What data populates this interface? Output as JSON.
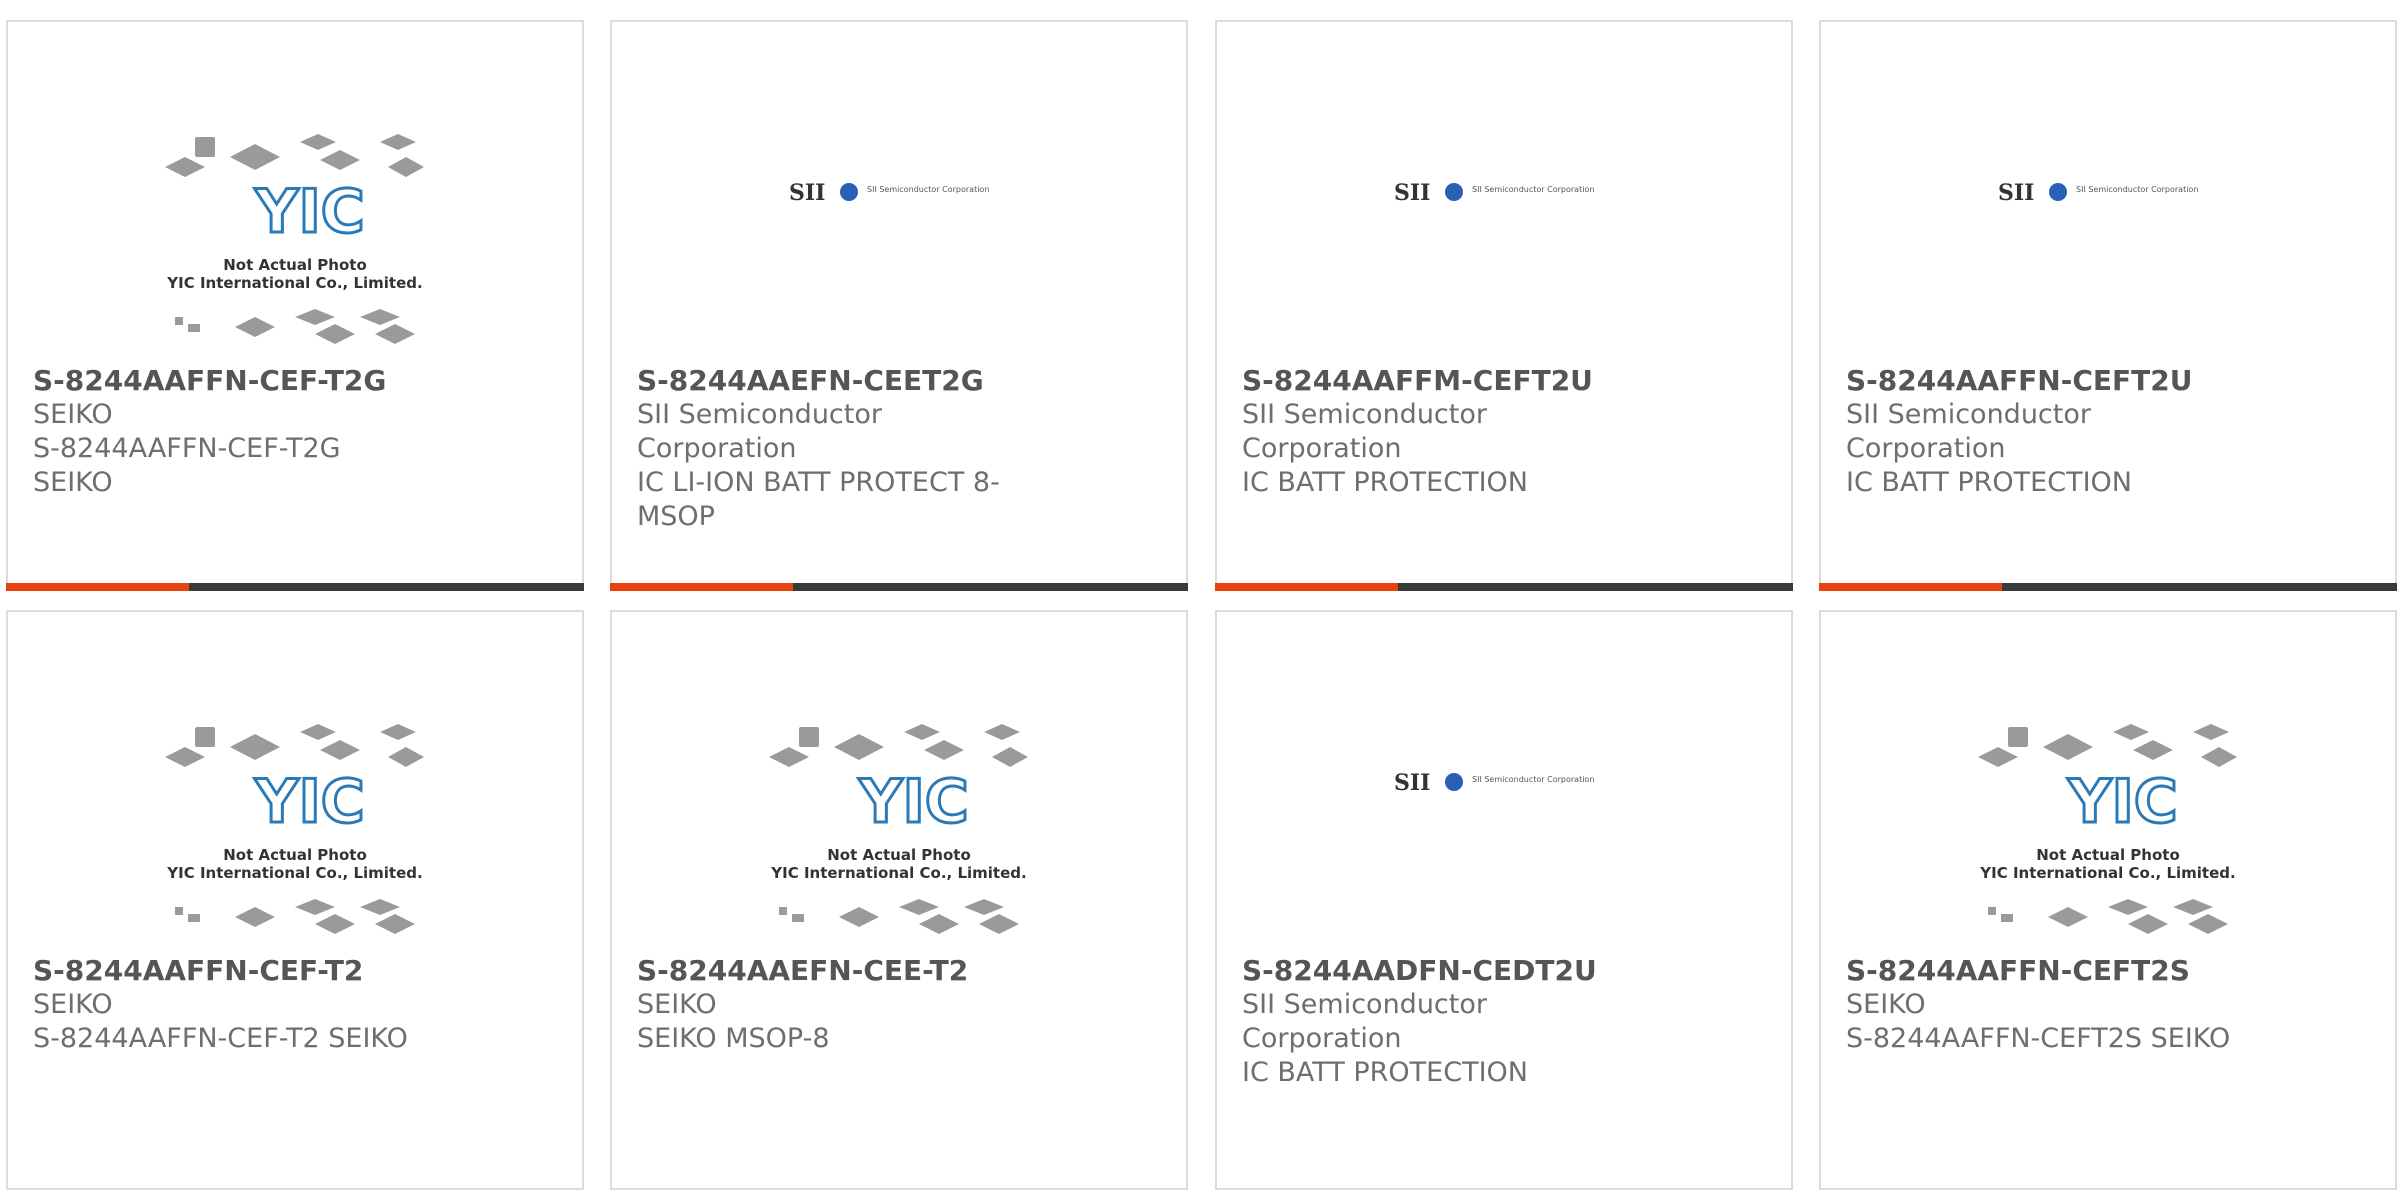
{
  "photo_caption": {
    "line1": "Not Actual Photo",
    "line2": "YIC International Co., Limited.",
    "logo": "YIC"
  },
  "sii_logo": {
    "mark": "SII",
    "company": "SII Semiconductor Corporation"
  },
  "colors": {
    "accent": "#e8420f",
    "bar": "#3a3a3a",
    "border": "#dcdcdc",
    "title": "#555555",
    "text": "#6e6e6e"
  },
  "products": [
    {
      "part": "S-8244AAFFN-CEF-T2G",
      "manufacturer": "SEIKO",
      "description": "S-8244AAFFN-CEF-T2G SEIKO",
      "image": "yic-placeholder"
    },
    {
      "part": "S-8244AAEFN-CEET2G",
      "manufacturer": "SII Semiconductor Corporation",
      "description": "IC LI-ION BATT PROTECT 8-MSOP",
      "image": "sii-logo"
    },
    {
      "part": "S-8244AAFFM-CEFT2U",
      "manufacturer": "SII Semiconductor Corporation",
      "description": "IC BATT PROTECTION",
      "image": "sii-logo"
    },
    {
      "part": "S-8244AAFFN-CEFT2U",
      "manufacturer": "SII Semiconductor Corporation",
      "description": "IC BATT PROTECTION",
      "image": "sii-logo"
    },
    {
      "part": "S-8244AAFFN-CEF-T2",
      "manufacturer": "SEIKO",
      "description": "S-8244AAFFN-CEF-T2 SEIKO",
      "image": "yic-placeholder"
    },
    {
      "part": "S-8244AAEFN-CEE-T2",
      "manufacturer": "SEIKO",
      "description": "SEIKO MSOP-8",
      "image": "yic-placeholder"
    },
    {
      "part": "S-8244AADFN-CEDT2U",
      "manufacturer": "SII Semiconductor Corporation",
      "description": "IC BATT PROTECTION",
      "image": "sii-logo"
    },
    {
      "part": "S-8244AAFFN-CEFT2S",
      "manufacturer": "SEIKO",
      "description": "S-8244AAFFN-CEFT2S SEIKO",
      "image": "yic-placeholder"
    }
  ]
}
